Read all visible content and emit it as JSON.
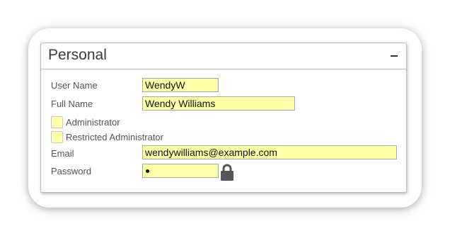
{
  "panel": {
    "title": "Personal",
    "collapse_icon": "minus-icon"
  },
  "fields": {
    "username": {
      "label": "User Name",
      "value": "WendyW"
    },
    "fullname": {
      "label": "Full Name",
      "value": "Wendy Williams"
    },
    "administrator": {
      "label": "Administrator",
      "checked": false
    },
    "restricted_admin": {
      "label": "Restricted Administrator",
      "checked": false
    },
    "email": {
      "label": "Email",
      "value": "wendywilliams@example.com"
    },
    "password": {
      "label": "Password",
      "masked": true,
      "lock_icon": "lock-icon"
    }
  },
  "colors": {
    "field_background": "#ffffa8",
    "border": "#b9b9b9"
  }
}
